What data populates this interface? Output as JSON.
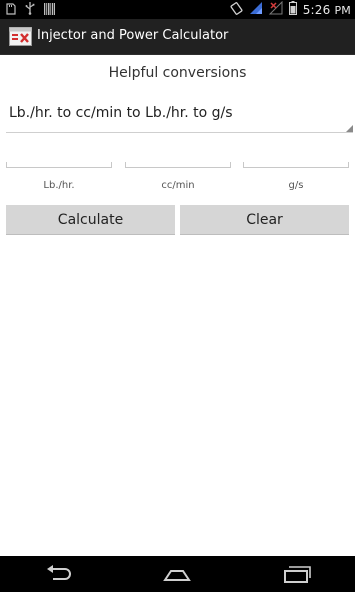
{
  "status_bar": {
    "time": "5:26",
    "time_suffix": "PM",
    "left_icons": [
      "sd-card-icon",
      "usb-icon",
      "barcode-icon"
    ],
    "right_icons": [
      "rotate-icon",
      "signal-icon",
      "no-signal-icon",
      "battery-icon"
    ]
  },
  "action_bar": {
    "title": "Injector and Power Calculator",
    "icon": "app-logo-icon"
  },
  "main": {
    "header": "Helpful conversions",
    "spinner_value": "Lb./hr. to cc/min to Lb./hr. to g/s",
    "fields": [
      {
        "label": "Lb./hr.",
        "value": ""
      },
      {
        "label": "cc/min",
        "value": ""
      },
      {
        "label": "g/s",
        "value": ""
      }
    ],
    "buttons": {
      "calculate": "Calculate",
      "clear": "Clear"
    }
  },
  "nav_bar": {
    "icons": [
      "back-icon",
      "home-icon",
      "recent-apps-icon"
    ]
  },
  "colors": {
    "status_bar": "#000000",
    "action_bar": "#212121",
    "button_bg": "#d6d6d6",
    "background": "#ffffff"
  }
}
